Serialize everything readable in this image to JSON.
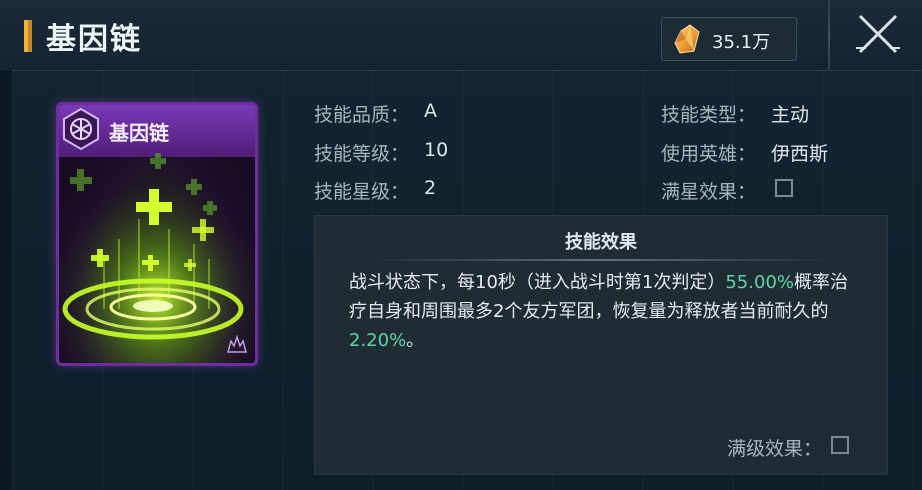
{
  "header": {
    "title": "基因链",
    "currency_value": "35.1万"
  },
  "card": {
    "name": "基因链"
  },
  "info": {
    "quality_label": "技能品质：",
    "quality_value": "A",
    "level_label": "技能等级：",
    "level_value": "10",
    "star_label": "技能星级：",
    "star_value": "2",
    "type_label": "技能类型：",
    "type_value": "主动",
    "hero_label": "使用英雄：",
    "hero_value": "伊西斯",
    "max_star_label": "满星效果："
  },
  "effect": {
    "title": "技能效果",
    "text_1": "战斗状态下，每10秒（进入战斗时第1次判定）",
    "pct_1": "55.00%",
    "text_2": "概率治疗自身和周围最多2个友方军团，恢复量为释放者当前耐久的",
    "pct_2": "2.20%",
    "text_3": "。",
    "max_level_label": "满级效果："
  },
  "colors": {
    "highlight": "#5ed6a6",
    "card_border": "#6e2f9e",
    "accent_gold": "#f3b23a"
  },
  "icons": {
    "currency": "crystal-icon",
    "close": "close-icon",
    "emblem": "hexagon-emblem-icon",
    "rank": "rank-flame-icon"
  }
}
